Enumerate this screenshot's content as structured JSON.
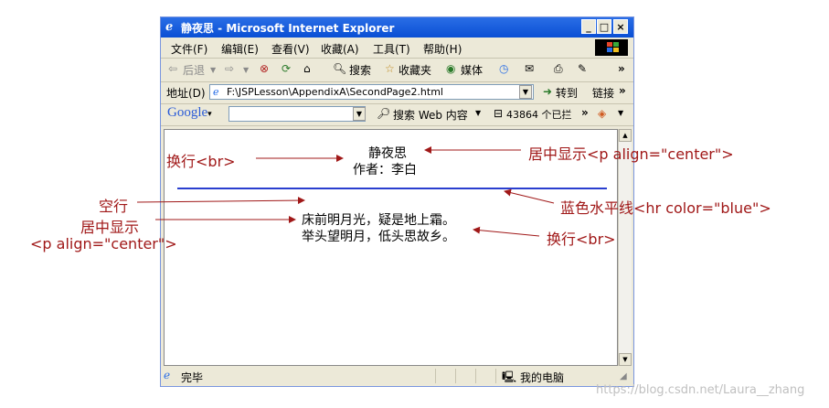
{
  "window": {
    "title": "静夜思 - Microsoft Internet Explorer",
    "controls": {
      "minimize": "_",
      "maximize": "□",
      "close": "×"
    }
  },
  "menu": [
    "文件(F)",
    "编辑(E)",
    "查看(V)",
    "收藏(A)",
    "工具(T)",
    "帮助(H)"
  ],
  "toolbar": {
    "back": "后退",
    "search": "搜索",
    "favorites": "收藏夹",
    "media": "媒体",
    "icons": [
      "back-arrow-icon",
      "forward-arrow-icon",
      "stop-icon",
      "refresh-icon",
      "home-icon",
      "search-icon",
      "favorites-icon",
      "media-icon",
      "history-icon",
      "mail-icon",
      "print-icon",
      "edit-icon"
    ]
  },
  "address": {
    "label": "地址(D)",
    "value": "F:\\JSPLesson\\AppendixA\\SecondPage2.html",
    "go": "转到",
    "links": "链接"
  },
  "google": {
    "logo": "Google",
    "search_web": "搜索 Web 内容",
    "blocked": "43864 个已拦",
    "more": "»"
  },
  "content": {
    "title": "静夜思",
    "author": "作者：李白",
    "line1": "床前明月光，疑是地上霜。",
    "line2": "举头望明月，低头思故乡。",
    "hr_color": "#2a3fcf"
  },
  "status": {
    "done": "完毕",
    "zone": "我的电脑"
  },
  "annotations": {
    "br_left": "换行<br>",
    "center_right": "居中显示<p align=\"center\">",
    "blank_line": "空行",
    "center_left_1": "居中显示",
    "center_left_2": "<p align=\"center\">",
    "hr": "蓝色水平线<hr color=\"blue\">",
    "br_right": "换行<br>"
  },
  "watermark": "https://blog.csdn.net/Laura__zhang",
  "colors": {
    "annotation": "#a01818",
    "titlebar": "#0a4fd4"
  }
}
